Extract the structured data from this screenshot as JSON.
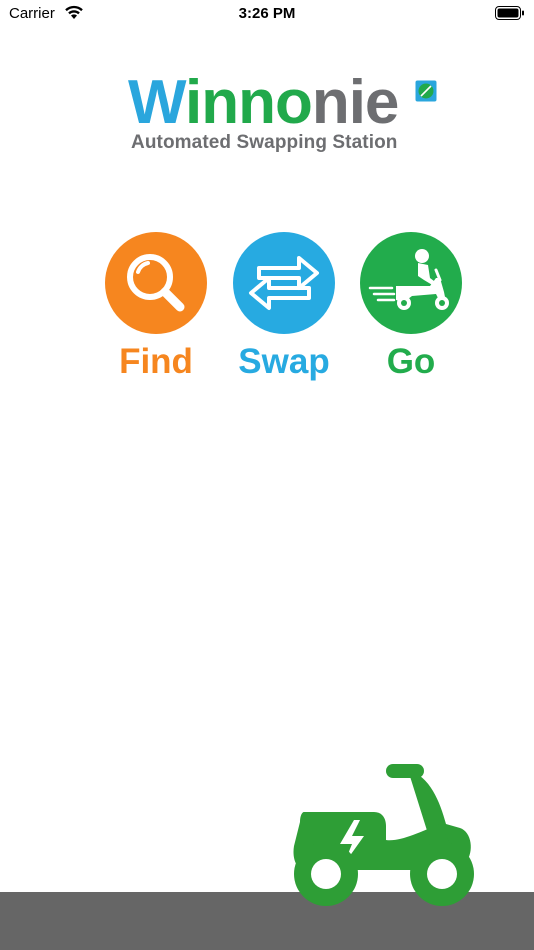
{
  "status_bar": {
    "carrier": "Carrier",
    "time": "3:26 PM"
  },
  "logo": {
    "brand_parts": [
      "W",
      "inno",
      "nie"
    ],
    "tagline": "Automated Swapping Station"
  },
  "actions": [
    {
      "label": "Find",
      "icon": "magnifier-icon",
      "color": "#f6861f"
    },
    {
      "label": "Swap",
      "icon": "swap-arrows-icon",
      "color": "#27aae1"
    },
    {
      "label": "Go",
      "icon": "scooter-rider-icon",
      "color": "#22ac4c"
    }
  ],
  "decor": {
    "scooter_icon": "electric-scooter-icon",
    "scooter_color": "#2e9e36",
    "ground_color": "#666666"
  }
}
